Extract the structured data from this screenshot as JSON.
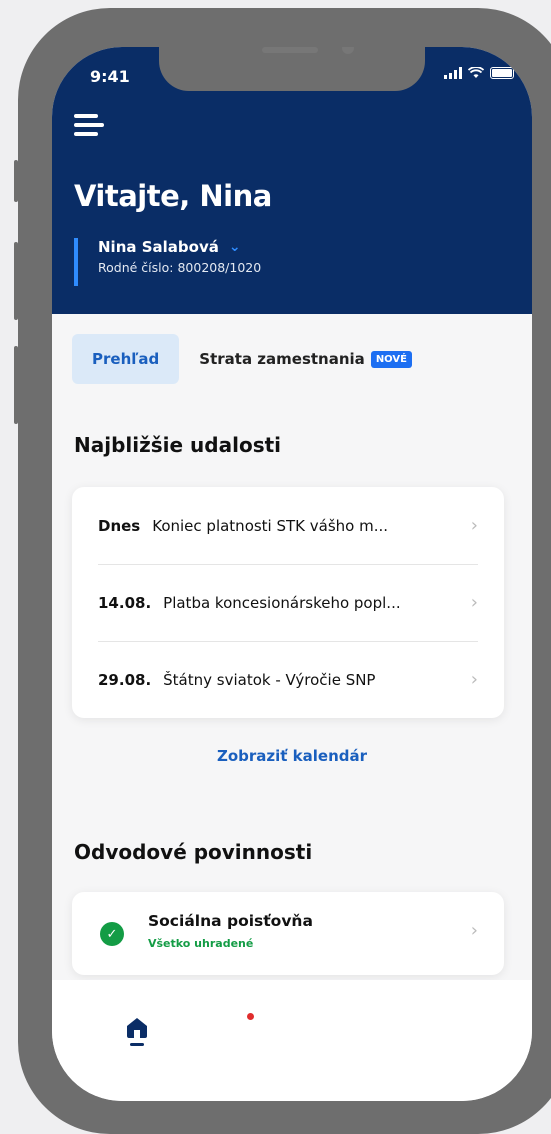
{
  "status_bar": {
    "time": "9:41"
  },
  "header": {
    "welcome": "Vitajte, Nina",
    "user_name": "Nina Salabová",
    "user_id": "Rodné číslo: 800208/1020"
  },
  "tabs": [
    {
      "label": "Prehľad"
    },
    {
      "label": "Strata zamestnania",
      "badge": "NOVÉ"
    }
  ],
  "events": {
    "title": "Najbližšie udalosti",
    "items": [
      {
        "date": "Dnes",
        "text": "Koniec platnosti STK vášho m..."
      },
      {
        "date": "14.08.",
        "text": "Platba koncesionárskeho popl..."
      },
      {
        "date": "29.08.",
        "text": "Štátny sviatok - Výročie SNP"
      }
    ],
    "link": "Zobraziť kalendár"
  },
  "duties": {
    "title": "Odvodové povinnosti",
    "items": [
      {
        "name": "Sociálna poisťovňa",
        "status": "Všetko uhradené"
      }
    ]
  },
  "colors": {
    "header": "#0a2d66",
    "accent": "#2f8cff",
    "success": "#139c45",
    "badge": "#1d6ff2"
  },
  "icons": [
    "menu-icon",
    "chevron-down-icon",
    "chevron-right-icon",
    "check-icon",
    "home-icon",
    "notification-dot"
  ]
}
